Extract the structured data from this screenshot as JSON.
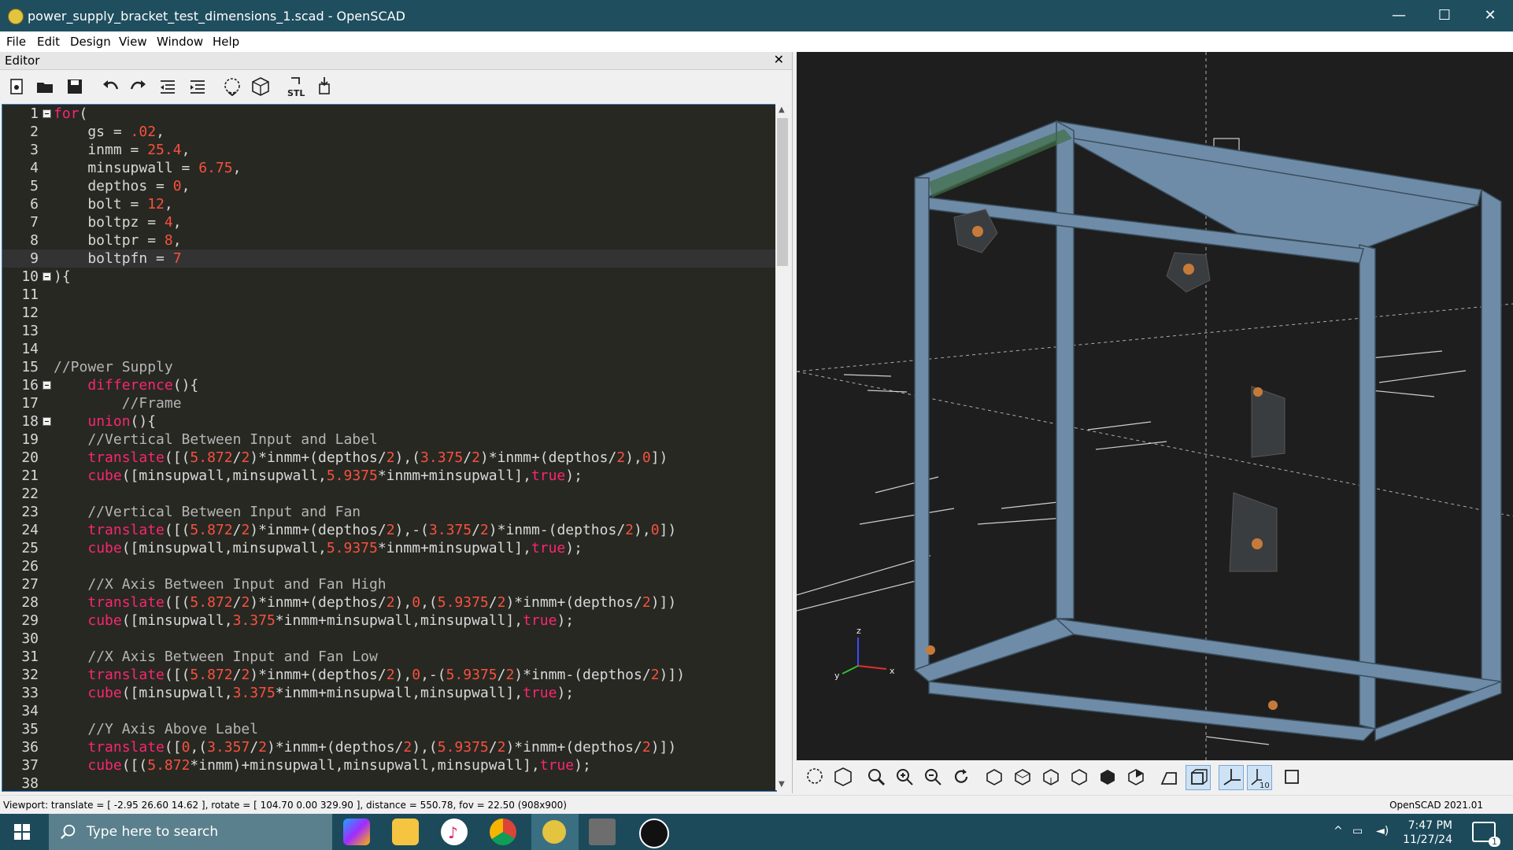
{
  "window": {
    "title": "power_supply_bracket_test_dimensions_1.scad - OpenSCAD",
    "minimize": "—",
    "maximize": "☐",
    "close": "✕"
  },
  "menu": [
    "File",
    "Edit",
    "Design",
    "View",
    "Window",
    "Help"
  ],
  "editor": {
    "header": "Editor",
    "close": "✕",
    "toolbar": [
      "new-file-icon",
      "open-file-icon",
      "save-icon",
      "undo-icon",
      "redo-icon",
      "unindent-icon",
      "indent-icon",
      "preview-icon",
      "render-icon",
      "export-stl-icon",
      "send-to-print-icon"
    ],
    "lines": [
      {
        "n": "1",
        "fold": true,
        "t": "for("
      },
      {
        "n": "2",
        "t": "    gs = .02,"
      },
      {
        "n": "3",
        "t": "    inmm = 25.4,"
      },
      {
        "n": "4",
        "t": "    minsupwall = 6.75,"
      },
      {
        "n": "5",
        "t": "    depthos = 0,"
      },
      {
        "n": "6",
        "t": "    bolt = 12,"
      },
      {
        "n": "7",
        "t": "    boltpz = 4,"
      },
      {
        "n": "8",
        "t": "    boltpr = 8,"
      },
      {
        "n": "9",
        "t": "    boltpfn = 7",
        "current": true
      },
      {
        "n": "10",
        "fold": true,
        "t": "){"
      },
      {
        "n": "11",
        "t": ""
      },
      {
        "n": "12",
        "t": ""
      },
      {
        "n": "13",
        "t": ""
      },
      {
        "n": "14",
        "t": ""
      },
      {
        "n": "15",
        "t": "//Power Supply"
      },
      {
        "n": "16",
        "fold": true,
        "t": "    difference(){"
      },
      {
        "n": "17",
        "t": "        //Frame"
      },
      {
        "n": "18",
        "fold": true,
        "t": "    union(){"
      },
      {
        "n": "19",
        "t": "    //Vertical Between Input and Label"
      },
      {
        "n": "20",
        "t": "    translate([(5.872/2)*inmm+(depthos/2),(3.375/2)*inmm+(depthos/2),0])"
      },
      {
        "n": "21",
        "t": "    cube([minsupwall,minsupwall,5.9375*inmm+minsupwall],true);"
      },
      {
        "n": "22",
        "t": ""
      },
      {
        "n": "23",
        "t": "    //Vertical Between Input and Fan"
      },
      {
        "n": "24",
        "t": "    translate([(5.872/2)*inmm+(depthos/2),-(3.375/2)*inmm-(depthos/2),0])"
      },
      {
        "n": "25",
        "t": "    cube([minsupwall,minsupwall,5.9375*inmm+minsupwall],true);"
      },
      {
        "n": "26",
        "t": ""
      },
      {
        "n": "27",
        "t": "    //X Axis Between Input and Fan High"
      },
      {
        "n": "28",
        "t": "    translate([(5.872/2)*inmm+(depthos/2),0,(5.9375/2)*inmm+(depthos/2)])"
      },
      {
        "n": "29",
        "t": "    cube([minsupwall,3.375*inmm+minsupwall,minsupwall],true);"
      },
      {
        "n": "30",
        "t": ""
      },
      {
        "n": "31",
        "t": "    //X Axis Between Input and Fan Low"
      },
      {
        "n": "32",
        "t": "    translate([(5.872/2)*inmm+(depthos/2),0,-(5.9375/2)*inmm-(depthos/2)])"
      },
      {
        "n": "33",
        "t": "    cube([minsupwall,3.375*inmm+minsupwall,minsupwall],true);"
      },
      {
        "n": "34",
        "t": ""
      },
      {
        "n": "35",
        "t": "    //Y Axis Above Label"
      },
      {
        "n": "36",
        "t": "    translate([0,(3.357/2)*inmm+(depthos/2),(5.9375/2)*inmm+(depthos/2)])"
      },
      {
        "n": "37",
        "t": "    cube([(5.872*inmm)+minsupwall,minsupwall,minsupwall],true);"
      },
      {
        "n": "38",
        "t": ""
      }
    ]
  },
  "viewer": {
    "axis_labels": {
      "z": "z",
      "x": "x",
      "y": "y"
    },
    "toolbar": [
      "preview-icon",
      "render-icon",
      "view-all-icon",
      "zoom-in-icon",
      "zoom-out-icon",
      "reset-view-icon",
      "view-right-icon",
      "view-top-icon",
      "view-bottom-icon",
      "view-left-icon",
      "view-front-icon",
      "view-back-icon",
      "perspective-icon",
      "orthogonal-icon",
      "show-axes-icon",
      "show-scale-markers-icon",
      "show-edges-icon"
    ],
    "scale_label": "10"
  },
  "status": {
    "left": "Viewport: translate = [ -2.95 26.60 14.62 ], rotate = [ 104.70 0.00 329.90 ], distance = 550.78, fov = 22.50 (908x900)",
    "right": "OpenSCAD 2021.01"
  },
  "taskbar": {
    "search_placeholder": "Type here to search",
    "time": "7:47 PM",
    "date": "11/27/24",
    "notif": "1"
  }
}
